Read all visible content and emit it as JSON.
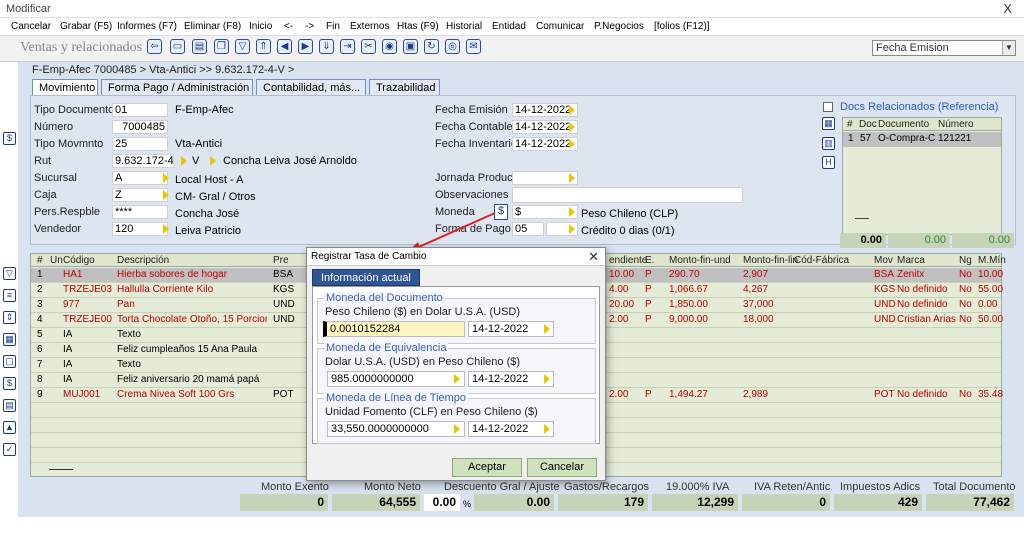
{
  "window": {
    "title": "Modificar",
    "close": "X"
  },
  "menu": [
    "Cancelar",
    "Grabar (F5)",
    "Informes (F7)",
    "Eliminar (F8)",
    "Inicio",
    "<-",
    "->",
    "Fin",
    "Externos",
    "Htas (F9)",
    "Historial",
    "Entidad",
    "Comunicar",
    "P.Negocios",
    "[folios (F12)]"
  ],
  "form_title": "Ventas y relacionados",
  "sort_combo": "Fecha Emision",
  "breadcrumb": "F-Emp-Afec 7000485 > Vta-Antici >> 9.632.172-4-V  >",
  "tabs": [
    "Movimiento",
    "Forma Pago / Administración",
    "Contabilidad, más...",
    "Trazabilidad"
  ],
  "header": {
    "tipo_documento": {
      "label": "Tipo Documento",
      "code": "01",
      "desc": "F-Emp-Afec"
    },
    "numero": {
      "label": "Número",
      "value": "7000485"
    },
    "tipo_movmnto": {
      "label": "Tipo Movmnto",
      "code": "25",
      "desc": "Vta-Antici"
    },
    "rut": {
      "label": "Rut",
      "value": "9.632.172-4",
      "suffix": "V",
      "name": "Concha Leiva José Arnoldo"
    },
    "sucursal": {
      "label": "Sucursal",
      "code": "A",
      "desc": "Local Host - A"
    },
    "caja": {
      "label": "Caja",
      "code": "Z",
      "desc": "CM- Gral / Otros"
    },
    "pers_resp": {
      "label": "Pers.Respble",
      "code": "****",
      "desc": "Concha José"
    },
    "vendedor": {
      "label": "Vendedor",
      "code": "120",
      "desc": "Leiva Patricio"
    },
    "fecha_emision": {
      "label": "Fecha Emisión",
      "value": "14-12-2022"
    },
    "fecha_contable": {
      "label": "Fecha Contable",
      "value": "14-12-2022"
    },
    "fecha_inventario": {
      "label": "Fecha Inventario",
      "value": "14-12-2022"
    },
    "jornada": {
      "label": "Jornada Produc",
      "value": ""
    },
    "observaciones": {
      "label": "Observaciones",
      "value": ""
    },
    "moneda": {
      "label": "Moneda",
      "code": "$",
      "desc": "Peso Chileno (CLP)"
    },
    "forma_pago": {
      "label": "Forma de Pago",
      "code": "05",
      "desc": "Crédito 0 dias (0/1)"
    }
  },
  "docs": {
    "title": "Docs Relacionados (Referencia)",
    "headers": [
      "#",
      "Doc",
      "Documento",
      "Número"
    ],
    "rows": [
      [
        "1",
        "57",
        "O-Compra-C",
        "121221"
      ]
    ],
    "totals": [
      "0.00",
      "0.00",
      "0.00"
    ]
  },
  "grid": {
    "headers": [
      "#",
      "Un",
      "Código",
      "Descripción",
      "Pre",
      "endiente",
      "E.",
      "Monto-fin-und",
      "Monto-fin-lin",
      "Cód-Fábrica",
      "Mov",
      "Marca",
      "Ng",
      "M.Mín"
    ],
    "rows": [
      [
        "1",
        "",
        "HA1",
        "Hierba sobores de hogar",
        "BSA",
        "10.00",
        "P",
        "290.70",
        "2,907",
        "",
        "BSA",
        "Zenitx",
        "No",
        "10.00"
      ],
      [
        "2",
        "",
        "TRZEJE03",
        "Hallulla Corriente Kilo",
        "KGS",
        "4.00",
        "P",
        "1,066.67",
        "4,267",
        "",
        "KGS",
        "No definido",
        "No",
        "55.00"
      ],
      [
        "3",
        "",
        "977",
        "Pan",
        "UND",
        "20.00",
        "P",
        "1,850.00",
        "37,000",
        "",
        "UND",
        "No definido",
        "No",
        "0.00"
      ],
      [
        "4",
        "",
        "TRZEJE00",
        "Torta Chocolate Otoño, 15 Porciones",
        "UND",
        "2.00",
        "P",
        "9,000.00",
        "18,000",
        "",
        "UND",
        "Cristian Arias",
        "No",
        "50.00"
      ],
      [
        "5",
        "",
        "IA",
        "Texto",
        "",
        "",
        "",
        "",
        "",
        "",
        "",
        "",
        "",
        ""
      ],
      [
        "6",
        "",
        "IA",
        "Feliz cumpleaños 15 Ana Paula",
        "",
        "",
        "",
        "",
        "",
        "",
        "",
        "",
        "",
        ""
      ],
      [
        "7",
        "",
        "IA",
        "Texto",
        "",
        "",
        "",
        "",
        "",
        "",
        "",
        "",
        "",
        ""
      ],
      [
        "8",
        "",
        "IA",
        "Feliz aniversario 20 mamá  papá",
        "",
        "",
        "",
        "",
        "",
        "",
        "",
        "",
        "",
        ""
      ],
      [
        "9",
        "",
        "MUJ001",
        "Crema Nivea Soft 100 Grs",
        "POT",
        "2.00",
        "P",
        "1,494.27",
        "2,989",
        "",
        "POT",
        "No definido",
        "No",
        "35.48"
      ]
    ]
  },
  "totals": {
    "monto_exento": {
      "label": "Monto Exento",
      "value": "0"
    },
    "monto_neto": {
      "label": "Monto Neto",
      "value": "64,555"
    },
    "descuento": {
      "label": "Descuento Gral / Ajuste",
      "value": "0.00",
      "pct": "%",
      "amount": "0.00"
    },
    "gastos": {
      "label": "Gastos/Recargos",
      "value": "179"
    },
    "iva": {
      "label": "19.000% IVA",
      "value": "12,299"
    },
    "iva_reten": {
      "label": "IVA Reten/Antic",
      "value": "0"
    },
    "impuestos": {
      "label": "Impuestos Adics",
      "value": "429"
    },
    "total": {
      "label": "Total Documento",
      "value": "77,462"
    }
  },
  "dialog": {
    "title": "Registrar Tasa de Cambio",
    "close": "✕",
    "tab": "Información actual",
    "groups": [
      {
        "legend": "Moneda del Documento",
        "desc": "Peso Chileno ($) en Dolar U.S.A. (USD)",
        "value": "0.0010152284",
        "date": "14-12-2022"
      },
      {
        "legend": "Moneda de Equivalencia",
        "desc": "Dolar U.S.A. (USD) en Peso Chileno ($)",
        "value": "985.0000000000",
        "date": "14-12-2022"
      },
      {
        "legend": "Moneda de Línea de Tiempo",
        "desc": "Unidad Fomento (CLF) en Peso Chileno ($)",
        "value": "33,550.0000000000",
        "date": "14-12-2022"
      }
    ],
    "accept": "Aceptar",
    "cancel": "Cancelar"
  },
  "colors": {
    "accent": "#2f5597",
    "red_text": "#c00000",
    "selected_row": "#c0c0c0",
    "grid_bg": "#e4ebd6"
  }
}
